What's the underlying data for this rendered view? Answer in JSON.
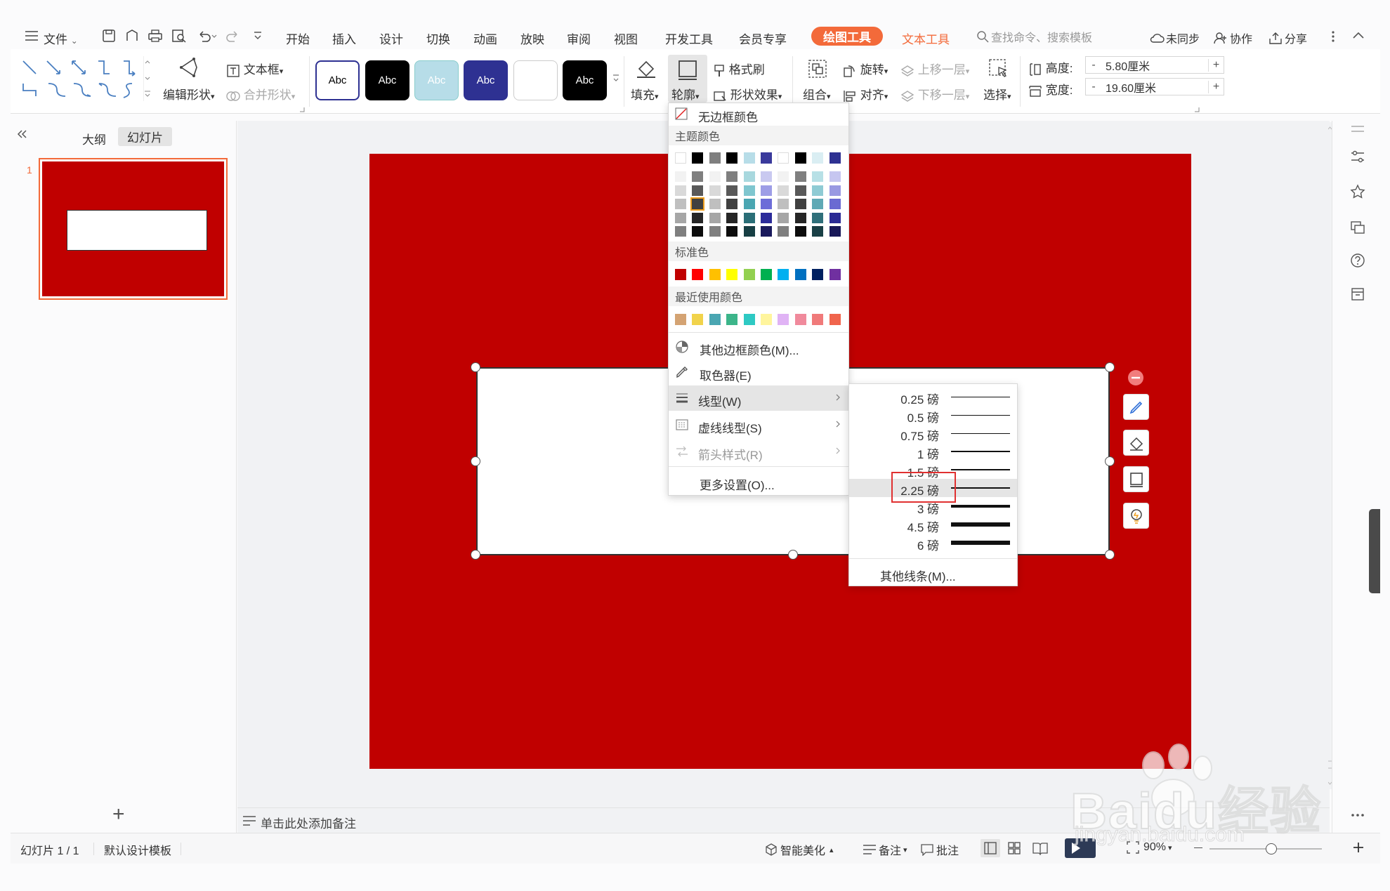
{
  "menu": {
    "file": "文件",
    "tabs": [
      "开始",
      "插入",
      "设计",
      "切换",
      "动画",
      "放映",
      "审阅",
      "视图",
      "开发工具",
      "会员专享"
    ],
    "drawing_tools": "绘图工具",
    "text_tools": "文本工具",
    "search_placeholder": "查找命令、搜索模板",
    "sync": "未同步",
    "collab": "协作",
    "share": "分享"
  },
  "ribbon": {
    "edit_shape": "编辑形状",
    "textbox": "文本框",
    "merge_shape": "合并形状",
    "style_samples": [
      "Abc",
      "Abc",
      "Abc",
      "Abc",
      "",
      "Abc"
    ],
    "fill": "填充",
    "outline": "轮廓",
    "format_painter": "格式刷",
    "shape_effects": "形状效果",
    "group": "组合",
    "rotate": "旋转",
    "align": "对齐",
    "bring_forward": "上移一层",
    "send_backward": "下移一层",
    "select": "选择",
    "height_label": "高度:",
    "height_value": "5.80厘米",
    "width_label": "宽度:",
    "width_value": "19.60厘米",
    "minus": "-",
    "plus": "+"
  },
  "left_pane": {
    "outline_tab": "大纲",
    "slides_tab": "幻灯片",
    "slide_number": "1",
    "add": "+"
  },
  "outline_menu": {
    "no_border": "无边框颜色",
    "theme_colors": "主题颜色",
    "standard_colors": "标准色",
    "recent_colors": "最近使用颜色",
    "more_colors": "其他边框颜色(M)...",
    "eyedropper": "取色器(E)",
    "line_type": "线型(W)",
    "dash_type": "虚线线型(S)",
    "arrow_style": "箭头样式(R)",
    "more_settings": "更多设置(O)...",
    "theme_top_row": [
      "#ffffff",
      "#000000",
      "#7f7f7f",
      "#000000",
      "#b7dde8",
      "#3a3a9c",
      "#ffffff",
      "#000000",
      "#daeef3",
      "#2e3192"
    ],
    "theme_columns": [
      [
        "#f2f2f2",
        "#d9d9d9",
        "#bfbfbf",
        "#a6a6a6",
        "#7f7f7f"
      ],
      [
        "#7f7f7f",
        "#595959",
        "#404040",
        "#262626",
        "#0d0d0d"
      ],
      [
        "#f2f2f2",
        "#d9d9d9",
        "#bfbfbf",
        "#a6a6a6",
        "#7f7f7f"
      ],
      [
        "#7f7f7f",
        "#595959",
        "#404040",
        "#262626",
        "#0d0d0d"
      ],
      [
        "#a8d8de",
        "#7fc6cf",
        "#4aa6b2",
        "#2a6e77",
        "#173f44"
      ],
      [
        "#c9c9f0",
        "#9d9de6",
        "#6d6dd8",
        "#2b2b9a",
        "#1a1a5c"
      ],
      [
        "#f2f2f2",
        "#d9d9d9",
        "#bfbfbf",
        "#a6a6a6",
        "#7f7f7f"
      ],
      [
        "#7f7f7f",
        "#595959",
        "#404040",
        "#262626",
        "#0d0d0d"
      ],
      [
        "#b7e0e6",
        "#8fcbd4",
        "#5fa9b5",
        "#2f6f7a",
        "#1a4046"
      ],
      [
        "#c6c6f0",
        "#9999e2",
        "#6a6ad2",
        "#2a2a95",
        "#181858"
      ]
    ],
    "standard": [
      "#c00000",
      "#ff0000",
      "#ffc000",
      "#ffff00",
      "#92d050",
      "#00b050",
      "#00b0f0",
      "#0070c0",
      "#002060",
      "#7030a0"
    ],
    "recent": [
      "#d4a373",
      "#f1d34b",
      "#4aa6b2",
      "#3cb58a",
      "#2ec9c3",
      "#fff59d",
      "#e0b3f5",
      "#f08a9c",
      "#f07a7a",
      "#f0644c"
    ]
  },
  "line_weights": {
    "items": [
      "0.25 磅",
      "0.5 磅",
      "0.75 磅",
      "1 磅",
      "1.5 磅",
      "2.25 磅",
      "3 磅",
      "4.5 磅",
      "6 磅"
    ],
    "weights_pt": [
      0.25,
      0.5,
      0.75,
      1,
      1.5,
      2.25,
      3,
      4.5,
      6
    ],
    "selected": "2.25 磅",
    "more_lines": "其他线条(M)..."
  },
  "notes_placeholder": "单击此处添加备注",
  "status": {
    "slide_counter": "幻灯片 1 / 1",
    "template": "默认设计模板",
    "smart_beautify": "智能美化",
    "notes": "备注",
    "comments": "批注",
    "zoom": "90%"
  },
  "watermark": "Baidu经验",
  "watermark_url": "jingyan.baidu.com",
  "colors": {
    "slide_bg": "#c00000",
    "accent_orange": "#f36a3a",
    "selection_highlight": "#e5e5e5",
    "red_box": "#e03030"
  }
}
